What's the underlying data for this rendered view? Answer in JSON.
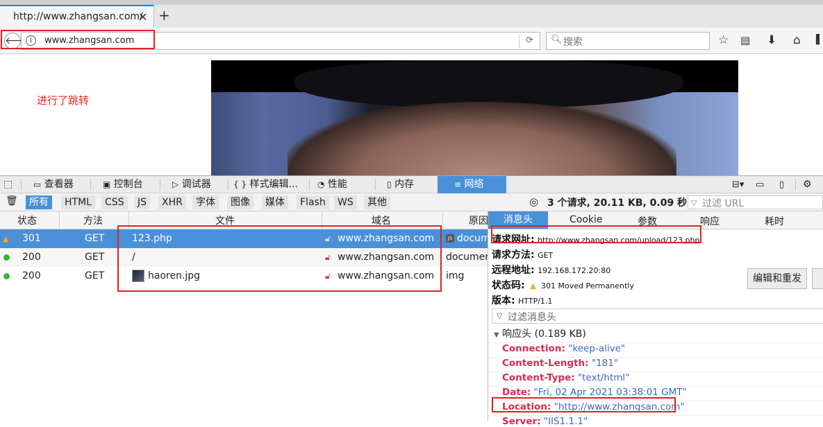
{
  "browser": {
    "tab_title": "http://www.zhangsan.com/",
    "tab_close": "✕",
    "new_tab": "+",
    "url": "www.zhangsan.com",
    "search_placeholder": "搜索"
  },
  "page": {
    "annotation_text": "进行了跳转"
  },
  "devtools": {
    "tabs": [
      {
        "label": "查看器"
      },
      {
        "label": "控制台"
      },
      {
        "label": "调试器"
      },
      {
        "label": "样式编辑..."
      },
      {
        "label": "性能"
      },
      {
        "label": "内存"
      },
      {
        "label": "网络"
      }
    ],
    "tab_icons": {
      "inspector": "{ }",
      "braces": "{ }"
    },
    "filters": [
      "所有",
      "HTML",
      "CSS",
      "JS",
      "XHR",
      "字体",
      "图像",
      "媒体",
      "Flash",
      "WS",
      "其他"
    ],
    "summary": "3 个请求, 20.11 KB, 0.09 秒",
    "url_filter_placeholder": "过滤 URL",
    "columns": [
      "状态",
      "方法",
      "文件",
      "域名",
      "原因"
    ],
    "requests": [
      {
        "status": "301",
        "method": "GET",
        "file": "123.php",
        "domain": "www.zhangsan.com",
        "cause": "document"
      },
      {
        "status": "200",
        "method": "GET",
        "file": "/",
        "domain": "www.zhangsan.com",
        "cause": "document"
      },
      {
        "status": "200",
        "method": "GET",
        "file": "haoren.jpg",
        "domain": "www.zhangsan.com",
        "cause": "img"
      }
    ],
    "detail_tabs": [
      "消息头",
      "Cookie",
      "参数",
      "响应",
      "耗时"
    ],
    "details": {
      "request_url_label": "请求网址:",
      "request_url": "http://www.zhangsan.com/upload/123.php",
      "method_label": "请求方法:",
      "method": "GET",
      "remote_label": "远程地址:",
      "remote": "192.168.172.20:80",
      "status_label": "状态码:",
      "status": "301 Moved Permanently",
      "version_label": "版本:",
      "version": "HTTP/1.1",
      "resend_button": "编辑和重发",
      "header_filter_placeholder": "过滤消息头",
      "response_headers_title": "响应头 (0.189 KB)",
      "headers": [
        {
          "key": "Connection:",
          "value": "\"keep-alive\""
        },
        {
          "key": "Content-Length:",
          "value": "\"181\""
        },
        {
          "key": "Content-Type:",
          "value": "\"text/html\""
        },
        {
          "key": "Date:",
          "value": "\"Fri, 02 Apr 2021 03:38:01 GMT\""
        },
        {
          "key": "Location:",
          "value": "\"http://www.zhangsan.com\""
        },
        {
          "key": "Server:",
          "value": "\"IIS1.1.1\""
        }
      ]
    }
  },
  "colors": {
    "accent": "#4a90d9",
    "annotation": "#e02020",
    "header_key": "#d62b4f",
    "header_value": "#3b68c4"
  }
}
